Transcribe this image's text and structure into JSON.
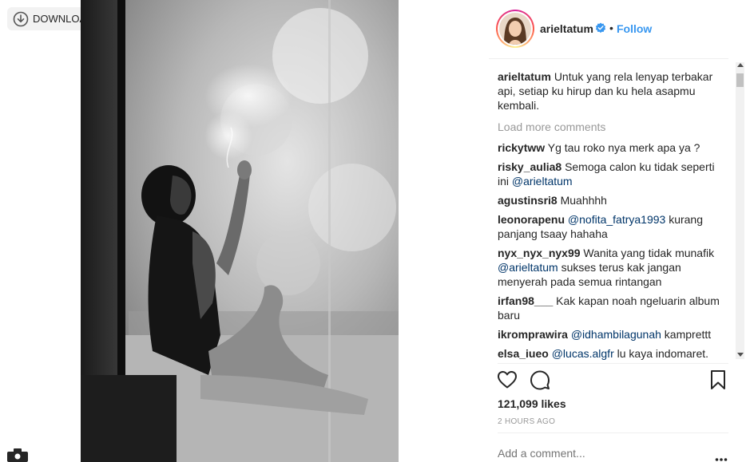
{
  "toolbar": {
    "download_label": "DOWNLOAD"
  },
  "post": {
    "username": "arieltatum",
    "follow_label": "Follow",
    "dot": "•",
    "caption": {
      "user": "arieltatum",
      "text": "Untuk yang rela lenyap terbakar api, setiap ku hirup dan ku hela asapmu kembali."
    },
    "load_more": "Load more comments",
    "comments": [
      {
        "user": "rickytww",
        "parts": [
          {
            "t": "Yg tau roko nya merk apa ya ?"
          }
        ]
      },
      {
        "user": "risky_aulia8",
        "parts": [
          {
            "t": "Semoga calon ku tidak seperti ini "
          },
          {
            "t": "@arieltatum",
            "m": true
          }
        ]
      },
      {
        "user": "agustinsri8",
        "parts": [
          {
            "t": "Muahhhh"
          }
        ]
      },
      {
        "user": "leonorapenu",
        "parts": [
          {
            "t": "@nofita_fatrya1993",
            "m": true
          },
          {
            "t": " kurang panjang tsaay hahaha"
          }
        ]
      },
      {
        "user": "nyx_nyx_nyx99",
        "parts": [
          {
            "t": "Wanita yang tidak munafik "
          },
          {
            "t": "@arieltatum",
            "m": true
          },
          {
            "t": " sukses terus kak jangan menyerah pada semua rintangan"
          }
        ]
      },
      {
        "user": "irfan98___",
        "parts": [
          {
            "t": "Kak kapan noah ngeluarin album baru"
          }
        ]
      },
      {
        "user": "ikromprawira",
        "parts": [
          {
            "t": "@idhambilagunah",
            "m": true
          },
          {
            "t": " kamprettt"
          }
        ]
      },
      {
        "user": "elsa_iueo",
        "parts": [
          {
            "t": "@lucas.algfr",
            "m": true
          },
          {
            "t": " lu kaya indomaret."
          }
        ]
      }
    ],
    "likes": "121,099 likes",
    "time_ago": "2 HOURS AGO",
    "add_comment_placeholder": "Add a comment..."
  },
  "icons": {
    "download": "download-icon",
    "verified": "verified-badge-icon",
    "heart": "heart-icon",
    "comment": "comment-icon",
    "save": "bookmark-icon",
    "more": "more-options-icon",
    "camera": "camera-icon"
  },
  "colors": {
    "link": "#3897f0",
    "mention": "#003569",
    "muted": "#999999",
    "text": "#262626"
  }
}
